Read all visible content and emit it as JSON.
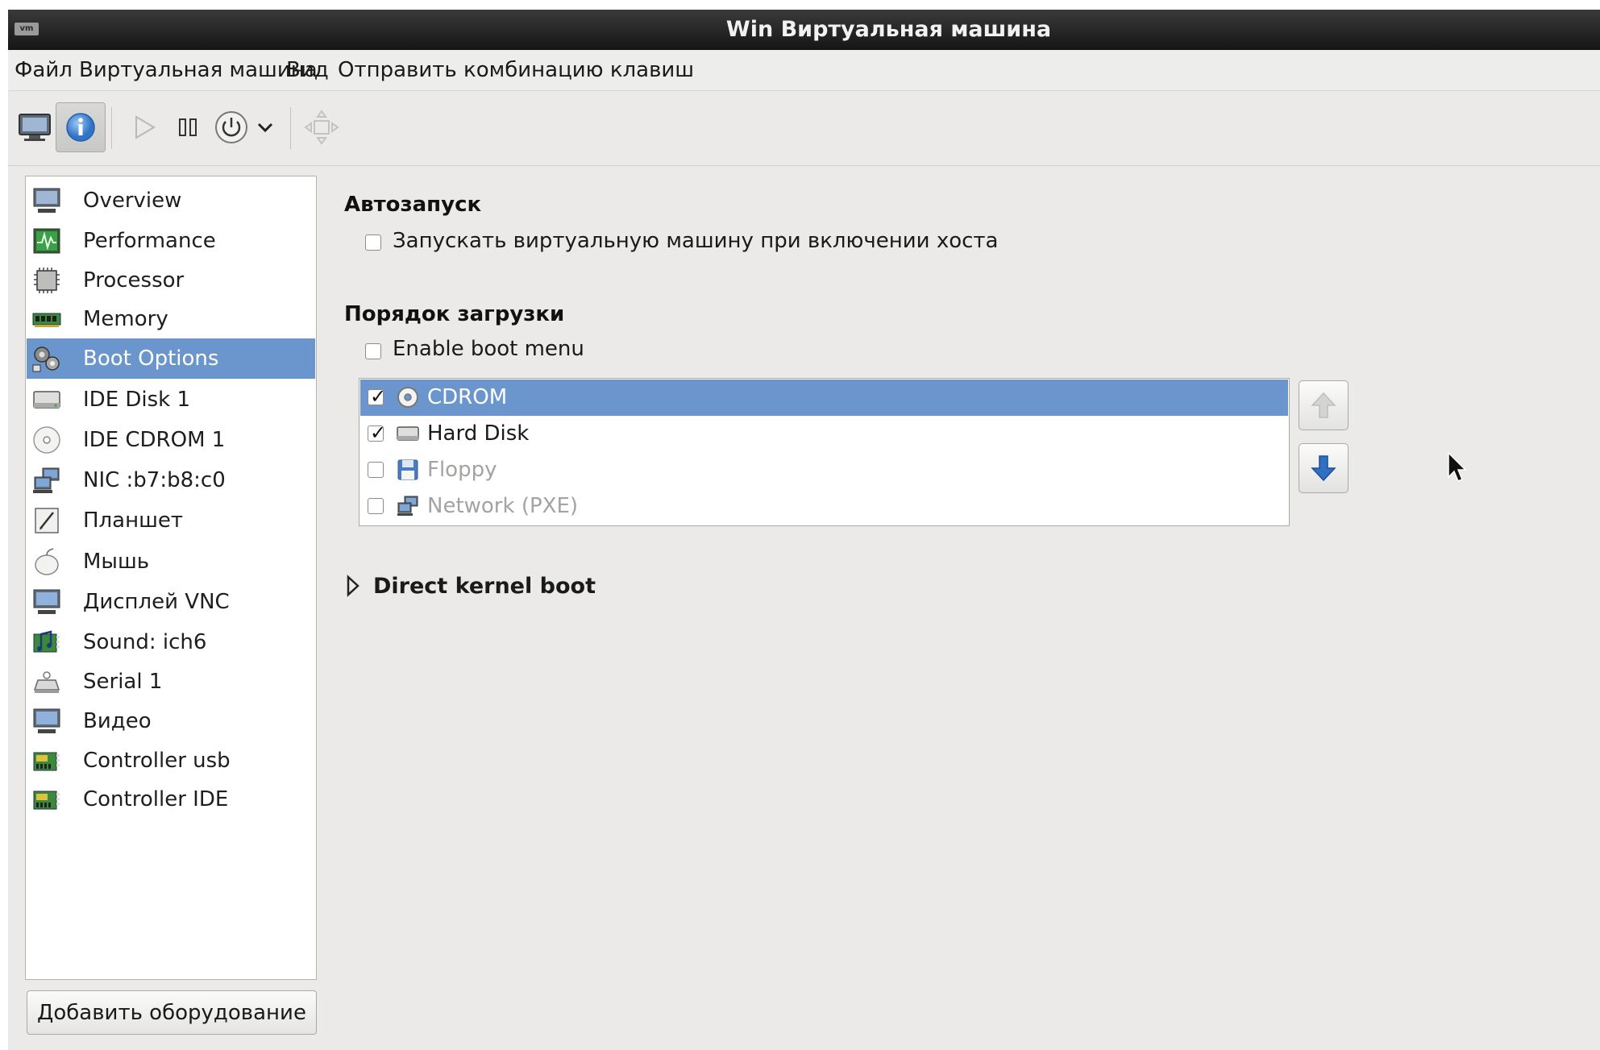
{
  "window": {
    "title": "Win Виртуальная машина",
    "wm_logo": "vm"
  },
  "menubar": {
    "items": [
      "Файл",
      "Виртуальная машина",
      "Вид",
      "Отправить комбинацию клавиш"
    ]
  },
  "toolbar": {
    "buttons": [
      {
        "icon": "monitor-icon",
        "state": "normal"
      },
      {
        "icon": "info-icon",
        "state": "active"
      },
      {
        "icon": "play-icon",
        "state": "disabled"
      },
      {
        "icon": "pause-icon",
        "state": "normal"
      },
      {
        "icon": "power-icon",
        "state": "normal"
      },
      {
        "icon": "chevron-down-icon",
        "state": "normal"
      },
      {
        "icon": "fullscreen-icon",
        "state": "disabled"
      }
    ]
  },
  "sidebar": {
    "items": [
      {
        "label": "Overview",
        "icon": "overview-icon"
      },
      {
        "label": "Performance",
        "icon": "performance-icon"
      },
      {
        "label": "Processor",
        "icon": "processor-icon"
      },
      {
        "label": "Memory",
        "icon": "memory-icon"
      },
      {
        "label": "Boot Options",
        "icon": "boot-options-icon",
        "selected": true
      },
      {
        "label": "IDE Disk 1",
        "icon": "disk-icon"
      },
      {
        "label": "IDE CDROM 1",
        "icon": "cdrom-icon"
      },
      {
        "label": "NIC :b7:b8:c0",
        "icon": "network-icon"
      },
      {
        "label": "Планшет",
        "icon": "tablet-icon"
      },
      {
        "label": "Мышь",
        "icon": "mouse-icon"
      },
      {
        "label": "Дисплей VNC",
        "icon": "display-icon"
      },
      {
        "label": "Sound: ich6",
        "icon": "sound-icon"
      },
      {
        "label": "Serial 1",
        "icon": "serial-icon"
      },
      {
        "label": "Видео",
        "icon": "video-icon"
      },
      {
        "label": "Controller usb",
        "icon": "controller-icon"
      },
      {
        "label": "Controller IDE",
        "icon": "controller-icon"
      }
    ],
    "add_hardware_label": "Добавить оборудование"
  },
  "autostart": {
    "title": "Автозапуск",
    "checkbox_label": "Запускать виртуальную машину при включении хоста",
    "checked": false
  },
  "boot_order": {
    "title": "Порядок загрузки",
    "enable_menu_label": "Enable boot menu",
    "enable_menu_checked": false,
    "devices": [
      {
        "label": "CDROM",
        "icon": "cdrom-icon",
        "checked": true,
        "selected": true
      },
      {
        "label": "Hard Disk",
        "icon": "disk-icon",
        "checked": true,
        "selected": false
      },
      {
        "label": "Floppy",
        "icon": "floppy-icon",
        "checked": false,
        "selected": false
      },
      {
        "label": "Network (PXE)",
        "icon": "network-icon",
        "checked": false,
        "selected": false
      }
    ],
    "move_up_icon": "arrow-up-icon",
    "move_down_icon": "arrow-down-icon",
    "check_glyph": "✓"
  },
  "direct_kernel_boot": {
    "label": "Direct kernel boot",
    "expanded": false
  },
  "colors": {
    "selection": "#6b95cd",
    "title_bar": "#1e1e1e",
    "background": "#ebeae8"
  }
}
